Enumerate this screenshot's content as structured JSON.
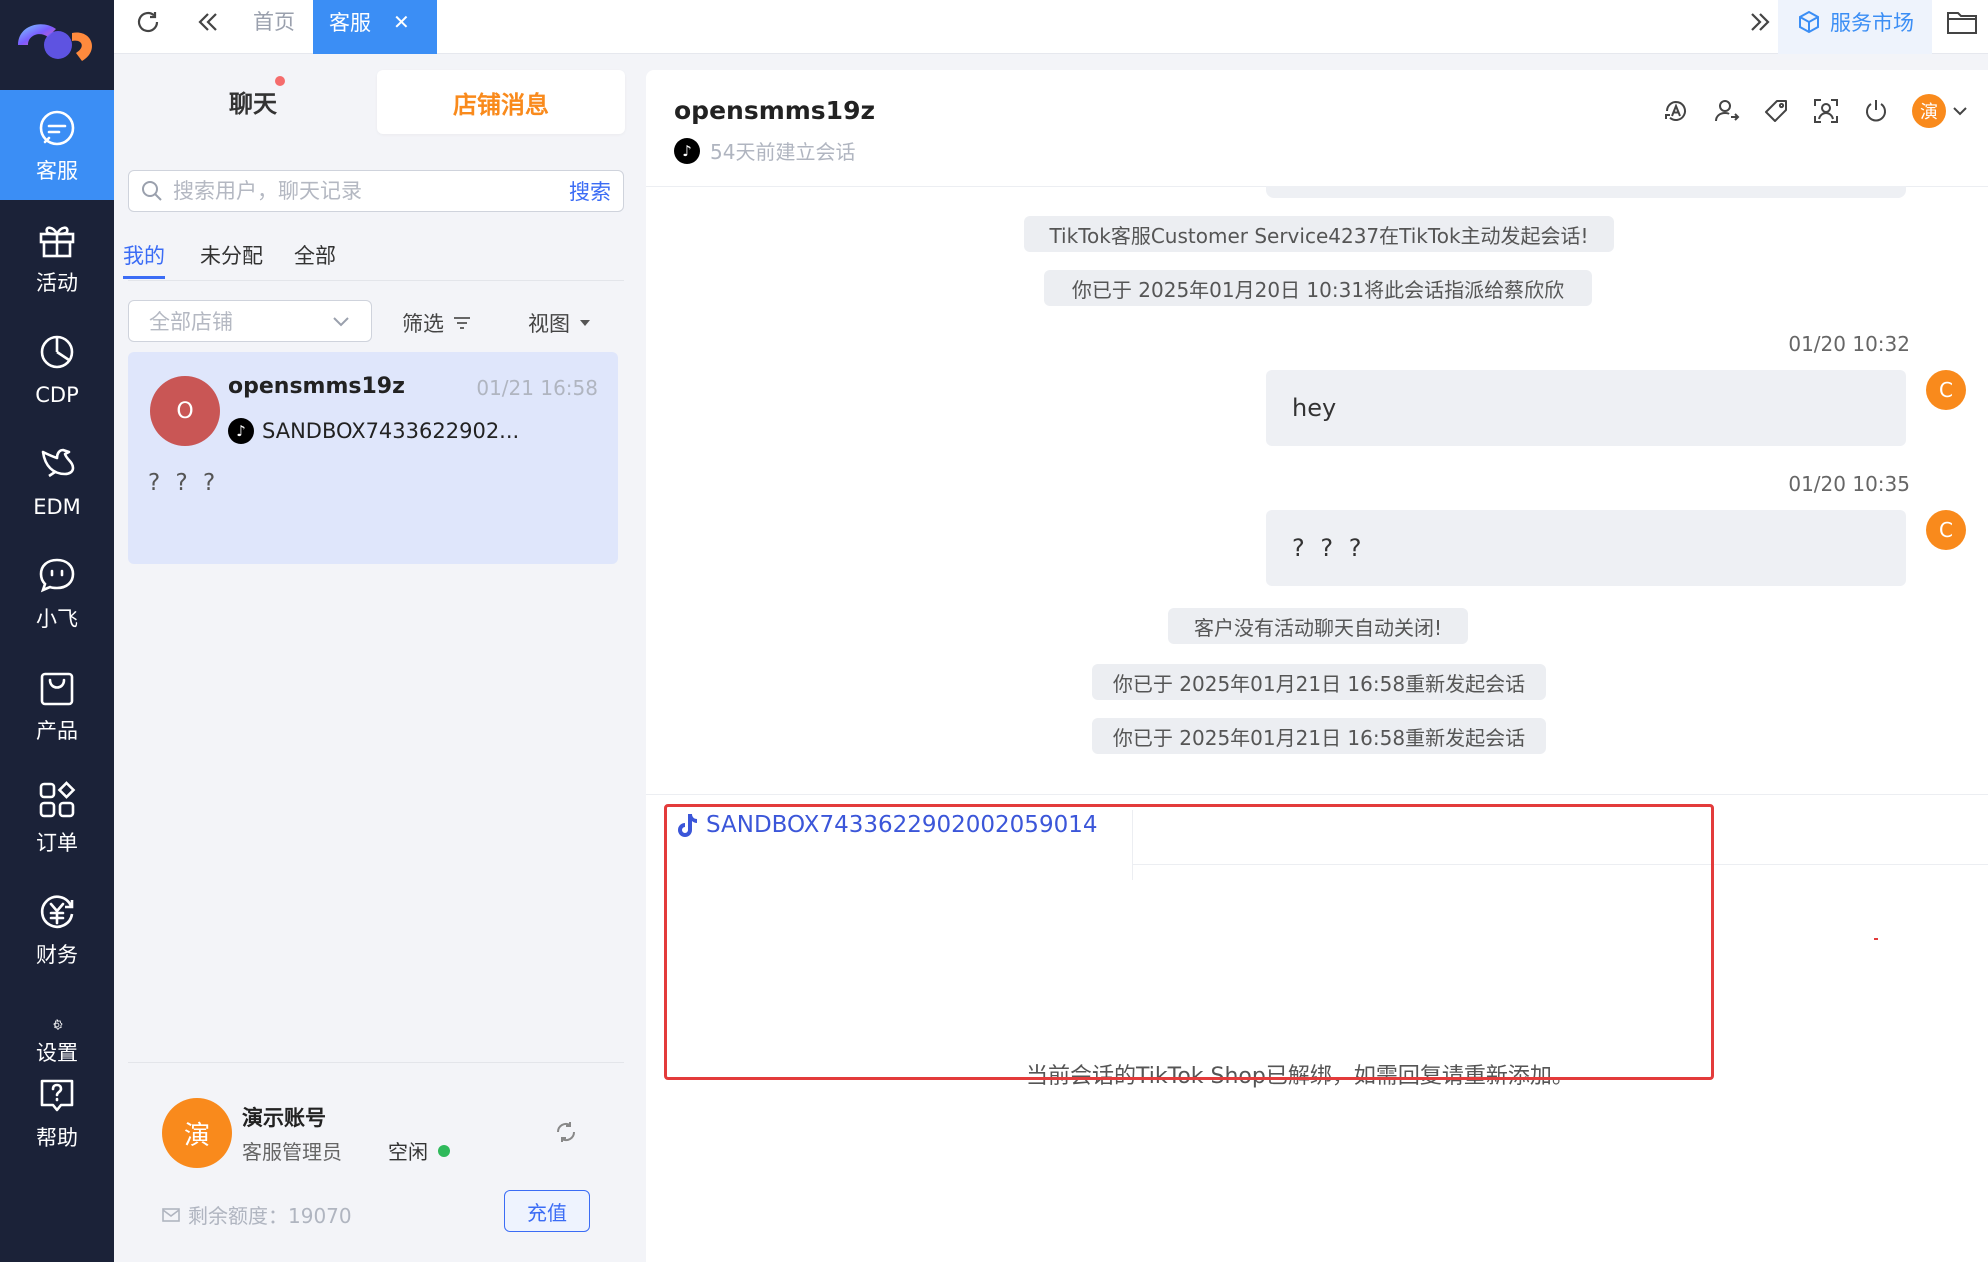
{
  "nav": {
    "items": [
      {
        "label": "客服",
        "icon": "chat-bubble-icon",
        "active": true
      },
      {
        "label": "活动",
        "icon": "gift-icon"
      },
      {
        "label": "CDP",
        "icon": "pie-chart-icon"
      },
      {
        "label": "EDM",
        "icon": "bird-icon"
      },
      {
        "label": "小飞",
        "icon": "robot-face-icon"
      },
      {
        "label": "产品",
        "icon": "shopping-bag-icon"
      },
      {
        "label": "订单",
        "icon": "grid-icon"
      },
      {
        "label": "财务",
        "icon": "yuan-icon"
      },
      {
        "label": "设置",
        "icon": "gear-icon"
      },
      {
        "label": "帮助",
        "icon": "help-icon"
      }
    ]
  },
  "topbar": {
    "tabs": [
      {
        "label": "首页"
      },
      {
        "label": "客服",
        "active": true
      }
    ],
    "market_label": "服务市场"
  },
  "panel": {
    "seg_chat": "聊天",
    "seg_shop": "店铺消息",
    "search_placeholder": "搜索用户，聊天记录",
    "search_button": "搜索",
    "tabs": [
      "我的",
      "未分配",
      "全部"
    ],
    "store_placeholder": "全部店铺",
    "filter_label": "筛选",
    "view_label": "视图",
    "conversation": {
      "avatar": "O",
      "name": "opensmms19z",
      "time": "01/21 16:58",
      "shop": "SANDBOX7433622902...",
      "preview": "? ? ?"
    },
    "account": {
      "avatar": "演",
      "name": "演示账号",
      "role": "客服管理员",
      "status": "空闲",
      "quota": "剩余额度：19070",
      "recharge": "充值"
    }
  },
  "chat": {
    "name": "opensmms19z",
    "subtitle": "54天前建立会话",
    "me_avatar": "演",
    "messages": {
      "sys1": "TikTok客服Customer Service4237在TikTok主动发起会话!",
      "sys2": "你已于 2025年01月20日 10:31将此会话指派给蔡欣欣",
      "t1": "01/20 10:32",
      "b1": "hey",
      "t2": "01/20 10:35",
      "b2": "? ? ?",
      "sys3": "客户没有活动聊天自动关闭!",
      "sys4": "你已于 2025年01月21日 16:58重新发起会话",
      "sys5": "你已于 2025年01月21日 16:58重新发起会话"
    },
    "sender_avatar": "C",
    "compose_tab": "SANDBOX7433622902002059014",
    "notice": "当前会话的TikTok Shop已解绑，如需回复请重新添加。"
  },
  "colors": {
    "nav_bg": "#1b2238",
    "accent_blue": "#3b8ef5",
    "orange": "#f98a1c",
    "highlight_red": "#e33b3b"
  }
}
